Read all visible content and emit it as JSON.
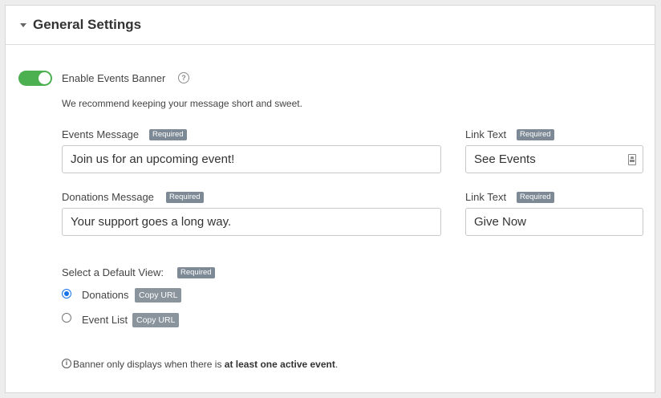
{
  "section": {
    "title": "General Settings"
  },
  "toggle": {
    "label": "Enable Events Banner",
    "enabled": true,
    "help_icon": "?"
  },
  "recommendation": "We recommend keeping your message short and sweet.",
  "required_badge": "Required",
  "events_message": {
    "label": "Events Message",
    "value": "Join us for an upcoming event!"
  },
  "events_link": {
    "label": "Link Text",
    "value": "See Events",
    "icon": "contact-card-icon"
  },
  "donations_message": {
    "label": "Donations Message",
    "value": "Your support goes a long way."
  },
  "donations_link": {
    "label": "Link Text",
    "value": "Give Now"
  },
  "default_view": {
    "label": "Select a Default View:",
    "options": [
      {
        "label": "Donations",
        "checked": true,
        "button": "Copy URL"
      },
      {
        "label": "Event List",
        "checked": false,
        "button": "Copy URL"
      }
    ]
  },
  "footnote": {
    "info_icon": "i",
    "prefix": "Banner only displays when there is ",
    "bold": "at least one active event",
    "suffix": "."
  },
  "colors": {
    "toggle_on": "#4caf50",
    "radio_selected": "#1a73e8",
    "badge": "#7d8a96"
  }
}
